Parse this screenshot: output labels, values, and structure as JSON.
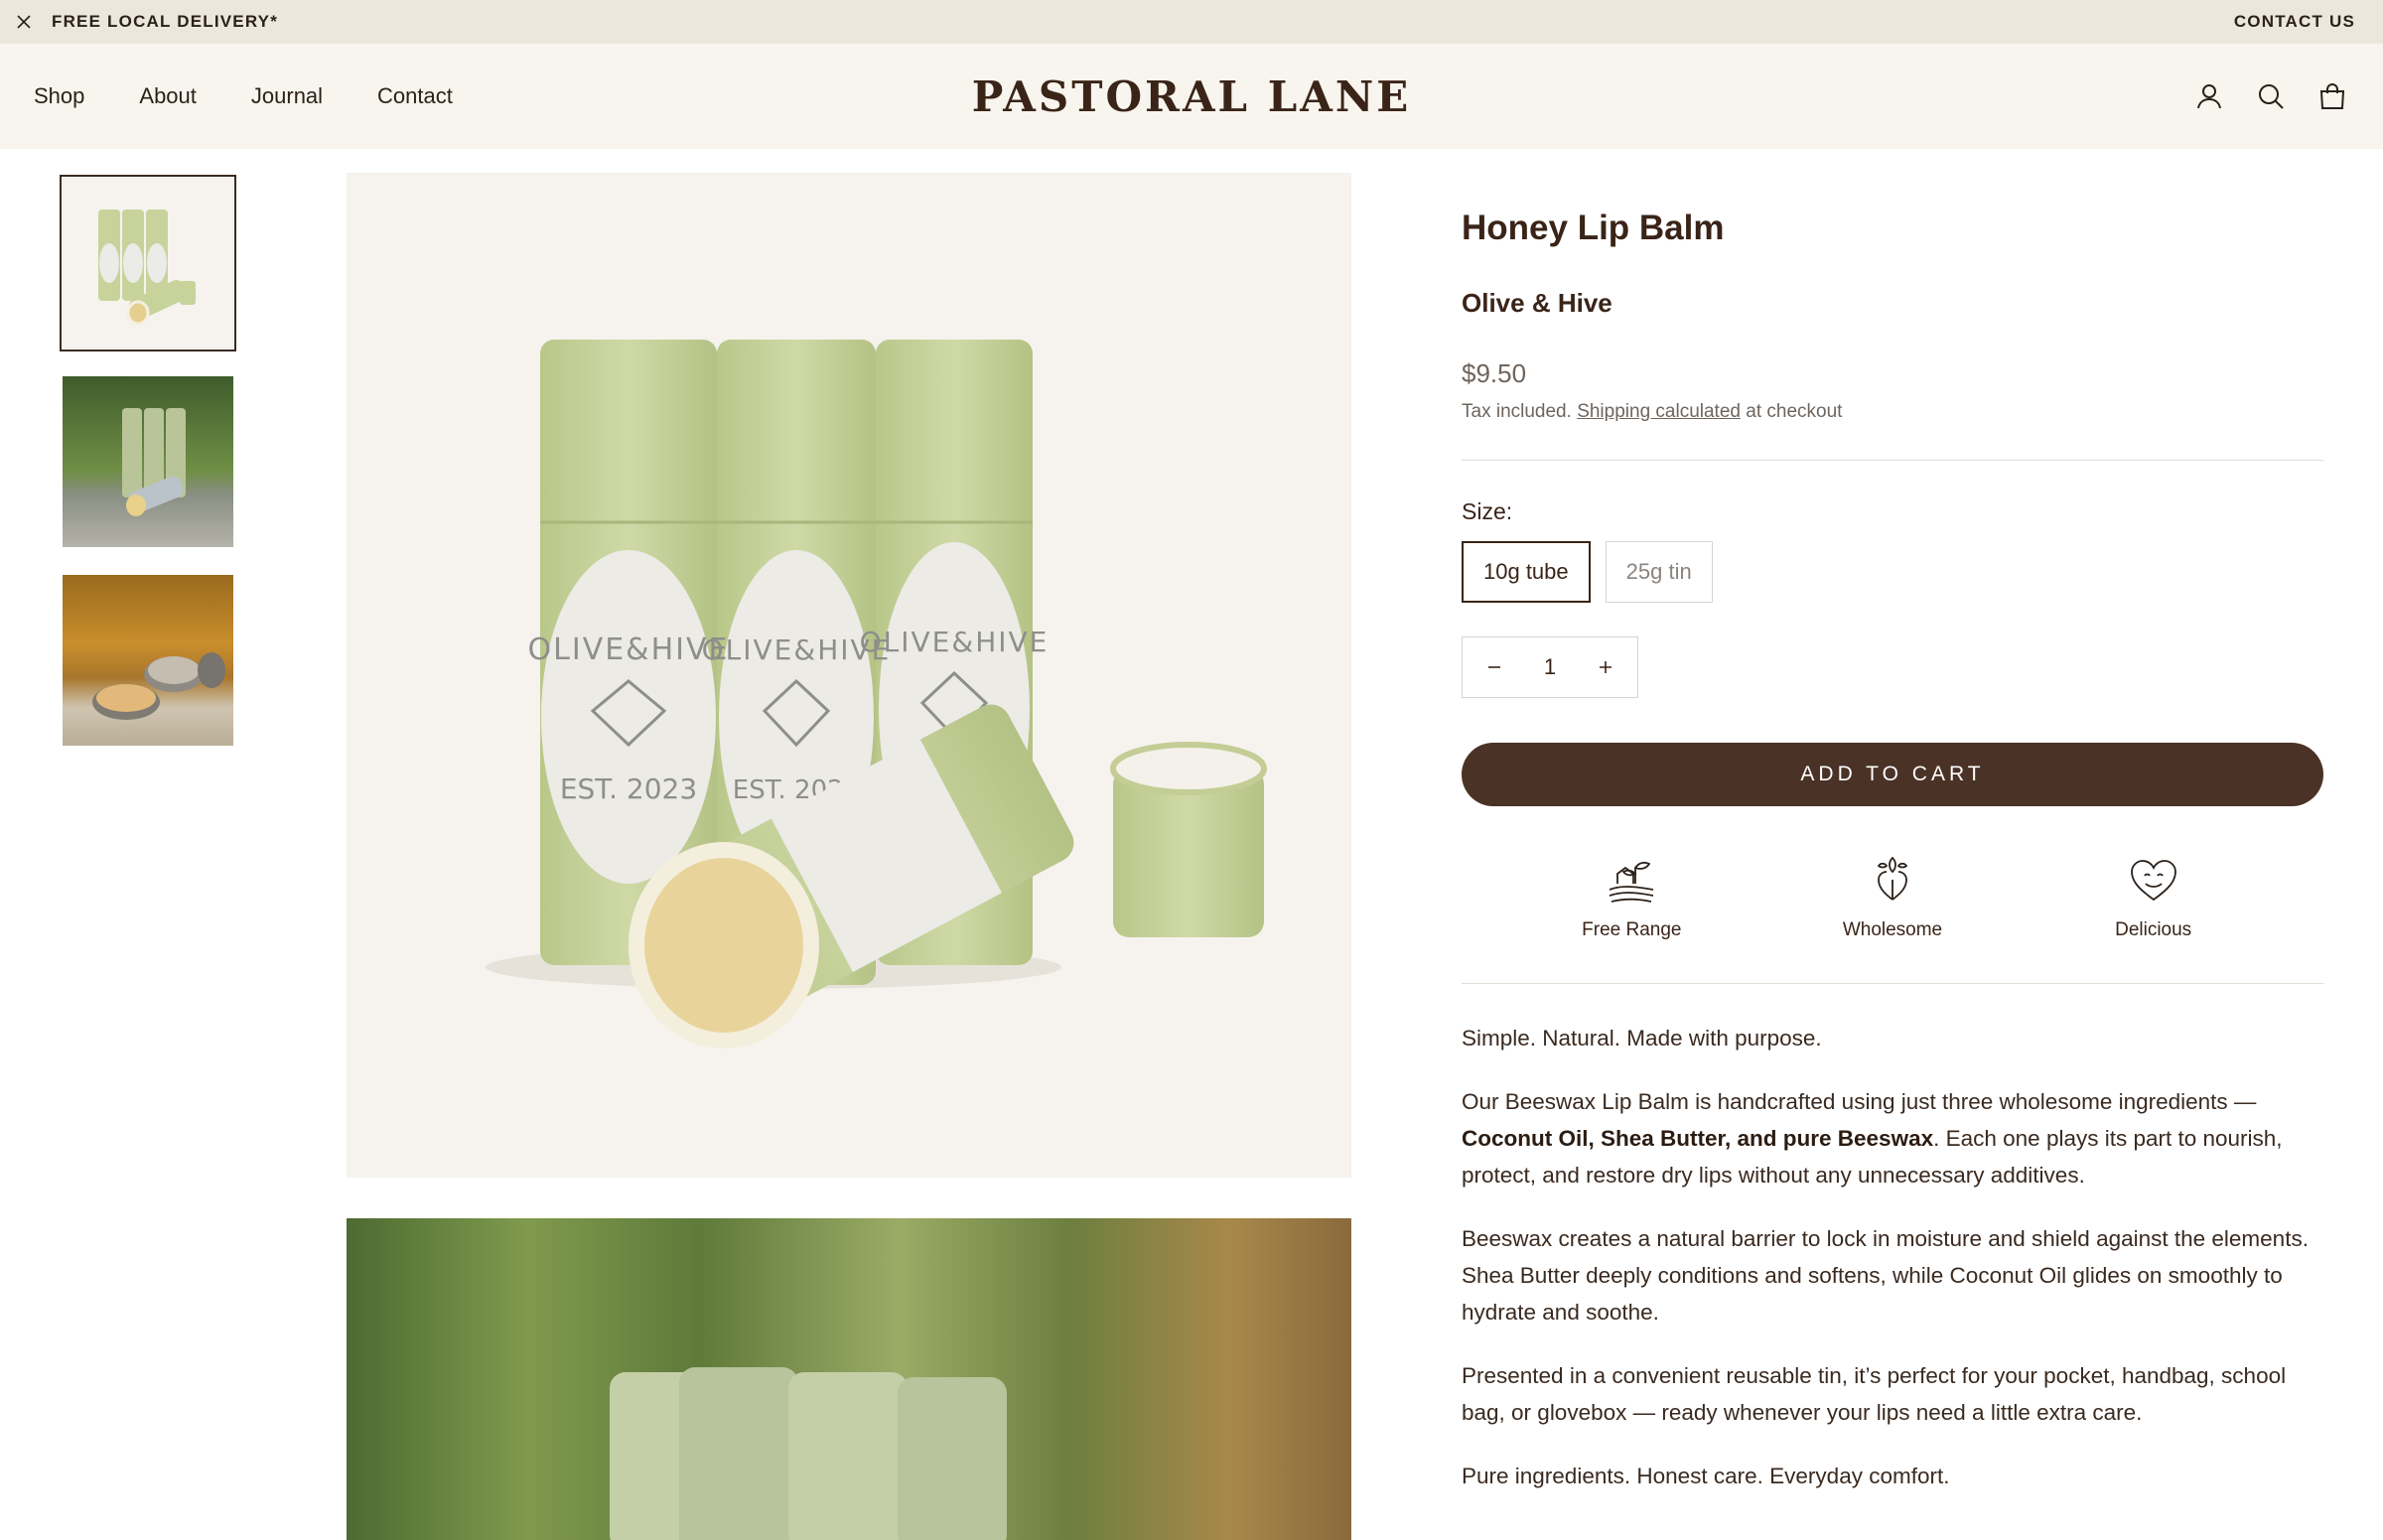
{
  "announcement": {
    "text": "FREE LOCAL DELIVERY*",
    "contact": "CONTACT US"
  },
  "header": {
    "logo": "PASTORAL LANE",
    "nav": [
      "Shop",
      "About",
      "Journal",
      "Contact"
    ],
    "icons": [
      "account-icon",
      "search-icon",
      "cart-icon"
    ]
  },
  "gallery": {
    "thumbnails": [
      "lip-balm-tubes",
      "tubes-in-grass",
      "tins-on-ledge"
    ],
    "main_label_text": "OLIVE&HIVE",
    "main_label_est": "EST. 2023"
  },
  "product": {
    "title": "Honey Lip Balm",
    "vendor": "Olive & Hive",
    "price": "$9.50",
    "tax_prefix": "Tax included.",
    "tax_link": "Shipping calculated",
    "tax_suffix": "at checkout",
    "size_label": "Size:",
    "sizes": [
      "10g tube",
      "25g tin"
    ],
    "quantity": "1",
    "add_to_cart": "ADD TO CART",
    "features": [
      "Free Range",
      "Wholesome",
      "Delicious"
    ],
    "description": {
      "p1": "Simple. Natural. Made with purpose.",
      "p2_start": "Our Beeswax Lip Balm is handcrafted using just three wholesome ingredients —",
      "p2_bold": "Coconut Oil, Shea Butter, and pure Beeswax",
      "p2_end": ". Each one plays its part to nourish, protect, and restore dry lips without any unnecessary additives.",
      "p3": "Beeswax creates a natural barrier to lock in moisture and shield against the elements. Shea Butter deeply conditions and softens, while Coconut Oil glides on smoothly to hydrate and soothe.",
      "p4": "Presented in a convenient reusable tin, it’s perfect for your pocket, handbag, school bag, or glovebox — ready whenever your lips need a little extra care.",
      "p5": "Pure ingredients. Honest care. Everyday comfort."
    }
  },
  "colors": {
    "announcement_bg": "#ebe7dc",
    "header_bg": "#f8f5ee",
    "brand_brown": "#4a3226",
    "tube_green": "#c8d39c"
  }
}
